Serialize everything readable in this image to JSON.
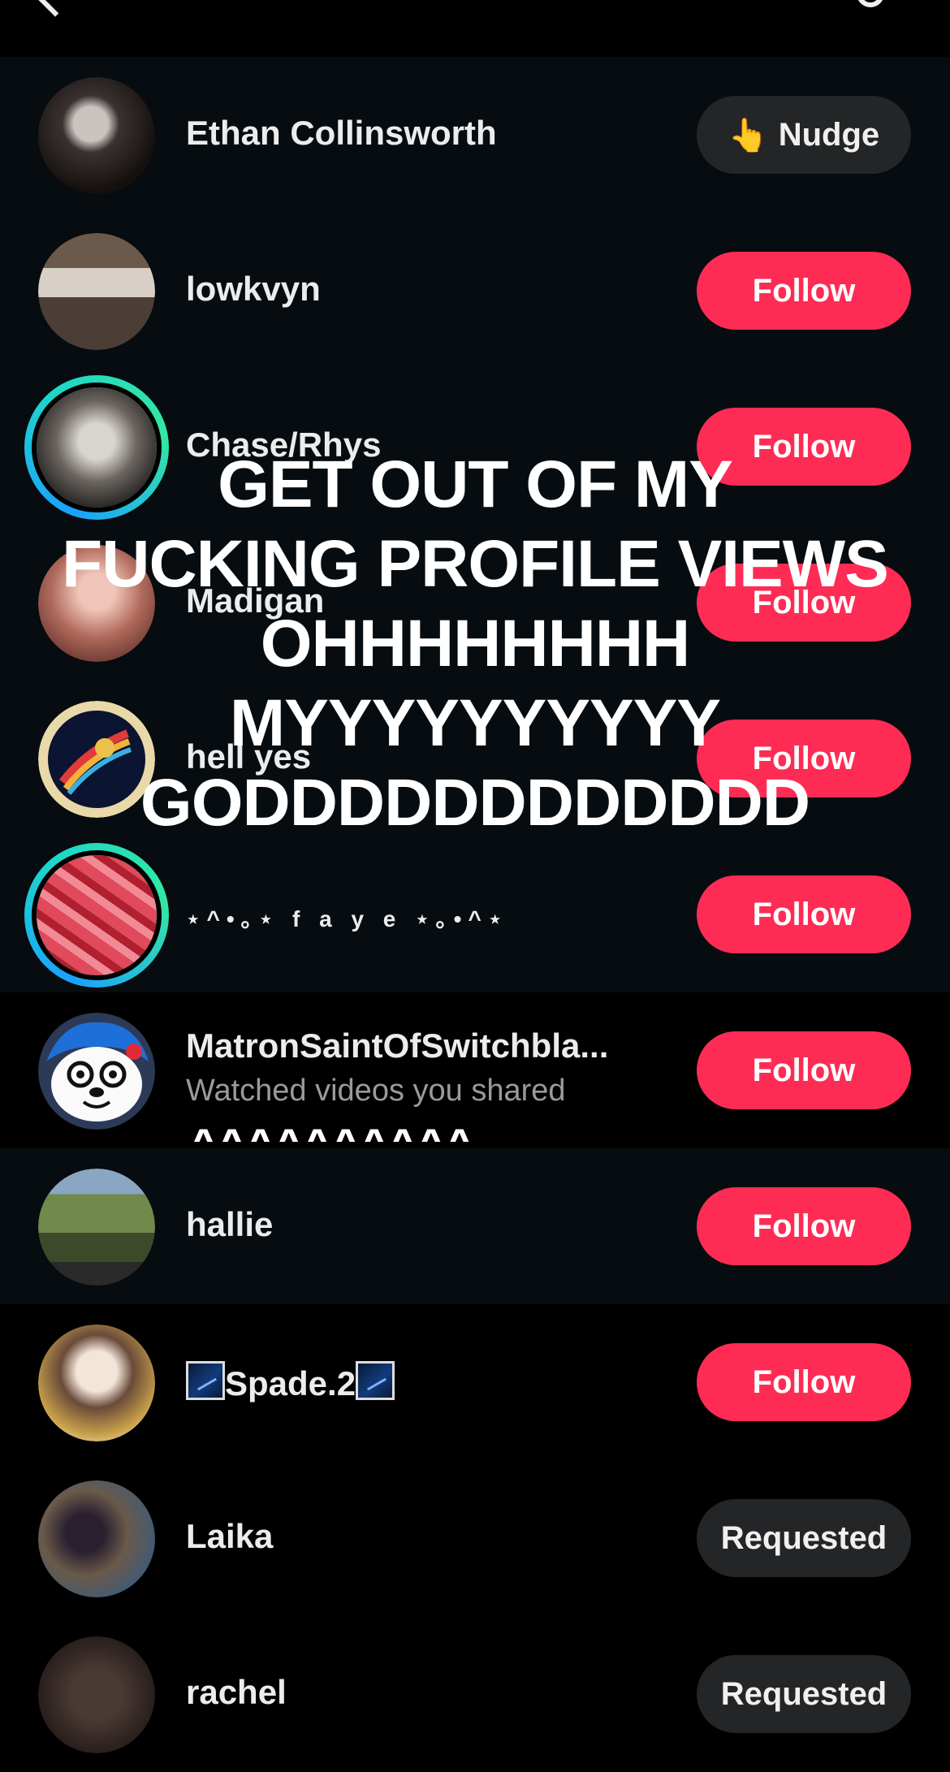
{
  "overlay_text": "GET OUT OF MY\nFUCKING PROFILE VIEWS\nOHHHHHHHH\nMYYYYYYYYYY\nGODDDDDDDDDDDD",
  "caret_text": "^^^^^^^^^^",
  "colors": {
    "follow": "#fe2c55",
    "secondary_button": "#232527",
    "row_highlight": "#060c0f",
    "ring": "#1ed6c9"
  },
  "users": [
    {
      "name": "Ethan Collinsworth",
      "button": "Nudge",
      "button_icon": "👆"
    },
    {
      "name": "lowkvyn",
      "button": "Follow"
    },
    {
      "name": "Chase/Rhys",
      "button": "Follow"
    },
    {
      "name": "Madigan",
      "button": "Follow"
    },
    {
      "name": "hell yes",
      "button": "Follow"
    },
    {
      "name": "⋆^•｡⋆ f a y e ⋆｡•^⋆",
      "button": "Follow"
    },
    {
      "name": "MatronSaintOfSwitchbla...",
      "subtitle": "Watched videos you shared",
      "button": "Follow"
    },
    {
      "name": "hallie",
      "button": "Follow"
    },
    {
      "name": "Spade.2",
      "button": "Follow"
    },
    {
      "name": "Laika",
      "button": "Requested"
    },
    {
      "name": "rachel",
      "button": "Requested"
    }
  ]
}
